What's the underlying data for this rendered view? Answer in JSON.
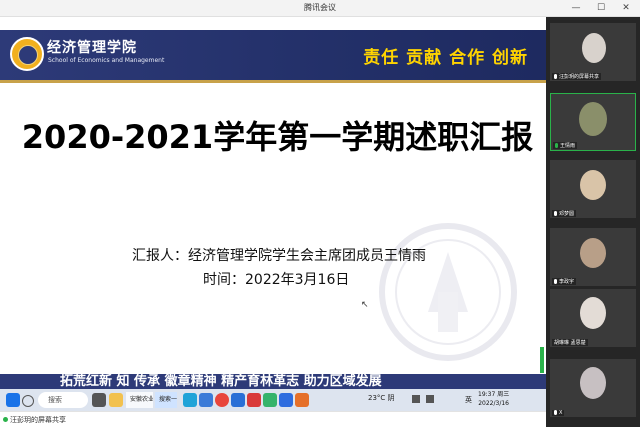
{
  "window": {
    "title": "腾讯会议",
    "controls": [
      "—",
      "☐",
      "✕"
    ]
  },
  "slide": {
    "school_name_cn": "经济管理学院",
    "school_name_en": "School of Economics and Management",
    "motto": "责任 贡献 合作 创新",
    "title": "2020-2021学年第一学期述职汇报",
    "reporter": "汇报人：经济管理学院学生会主席团成员王情雨",
    "time": "时间：2022年3月16日",
    "footer_slogan": "拓荒红新 知 传承 徽章精神 精产育林革志 助力区域发展"
  },
  "taskbar": {
    "search_placeholder": "搜索",
    "apps": [
      {
        "name": "browser-app",
        "label": "安徽农业大学"
      },
      {
        "name": "search-app",
        "label": "搜索一下"
      }
    ],
    "icons": [
      "start-icon",
      "search-icon",
      "task-view-icon",
      "file-explorer-icon",
      "edge-icon",
      "qq-icon",
      "chrome-icon",
      "mail-icon",
      "wps-icon",
      "music-icon",
      "photos-icon",
      "powerpoint-icon"
    ],
    "weather": "23°C 阴",
    "input_method": "英",
    "time": "19:37 周三",
    "date": "2022/3/16"
  },
  "status": {
    "share_text": "汪彭玥的屏幕共享"
  },
  "participants": [
    {
      "label": "汪彭玥的屏幕共享",
      "color": "#d8d2cc"
    },
    {
      "label": "王情雨",
      "color": "#8a8f6a",
      "speaking": true
    },
    {
      "label": "邓梦圆",
      "color": "#d9c4a8"
    },
    {
      "label": "李政宇",
      "color": "#b89f88"
    },
    {
      "label": "胡琳琳 孟思楚",
      "color": "#e3dcd6"
    },
    {
      "label": "X",
      "color": "#c7c0c2"
    }
  ],
  "colors": {
    "header_blue": "#2d3a78",
    "motto_yellow": "#ffd400",
    "accent_green": "#2ab24a"
  }
}
